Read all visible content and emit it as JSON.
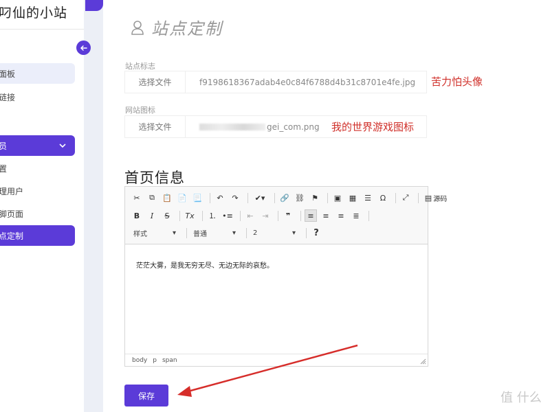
{
  "sidebar": {
    "brand": "叼仙的小站",
    "items": [
      {
        "label": "面板"
      },
      {
        "label": "链接"
      },
      {
        "label": "员"
      },
      {
        "label": "置"
      },
      {
        "label": "理用户"
      },
      {
        "label": "脚页面"
      },
      {
        "label": "点定制"
      }
    ]
  },
  "page": {
    "title": "站点定制"
  },
  "form": {
    "logo_label": "站点标志",
    "logo_button": "选择文件",
    "logo_file": "f9198618367adab4e0c84f6788d4b31c8701e4fe.jpg",
    "icon_label": "网站图标",
    "icon_button": "选择文件",
    "icon_file_suffix": "gei_com.png"
  },
  "annotations": {
    "logo_note": "苦力怕头像",
    "icon_note": "我的世界游戏图标"
  },
  "homepage": {
    "heading": "首页信息"
  },
  "editor": {
    "source_label": "源码",
    "style_combo": "样式",
    "format_combo": "普通",
    "size_combo": "2",
    "help": "?",
    "content": "茫茫大雾，是我无穷无尽、无边无际的哀愁。",
    "statusbar": [
      "body",
      "p",
      "span"
    ]
  },
  "save_button": "保存",
  "watermark": "值 什么",
  "colors": {
    "accent": "#5b3bd8",
    "annotation": "#d0302a"
  }
}
